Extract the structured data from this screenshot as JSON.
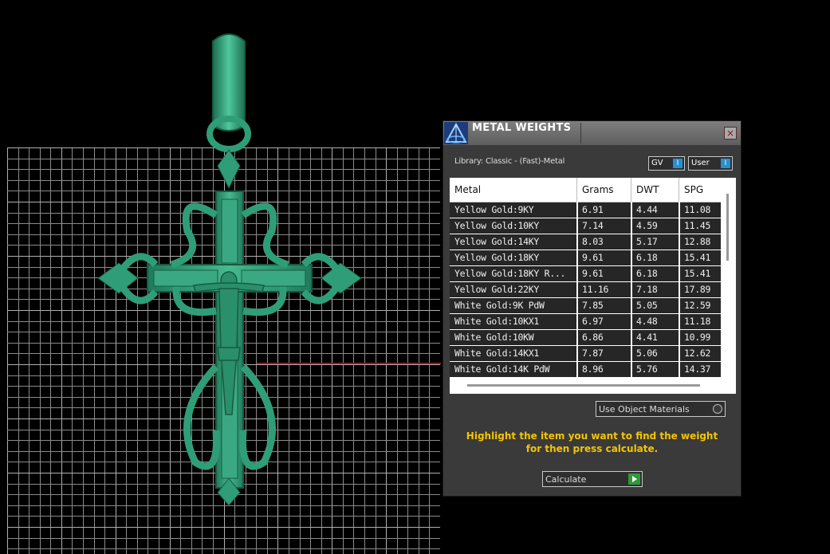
{
  "panel": {
    "title": "METAL WEIGHTS",
    "close_glyph": "×",
    "library_label": "Library: Classic - (Fast)-Metal",
    "toggles": {
      "gv_label": "GV",
      "user_label": "User",
      "indicator_glyph": "I"
    },
    "table": {
      "headers": [
        "Metal",
        "Grams",
        "DWT",
        "SPG"
      ],
      "rows": [
        {
          "metal": "Yellow Gold:9KY",
          "grams": "6.91",
          "dwt": "4.44",
          "spg": "11.08"
        },
        {
          "metal": "Yellow Gold:10KY",
          "grams": "7.14",
          "dwt": "4.59",
          "spg": "11.45"
        },
        {
          "metal": "Yellow Gold:14KY",
          "grams": "8.03",
          "dwt": "5.17",
          "spg": "12.88"
        },
        {
          "metal": "Yellow Gold:18KY",
          "grams": "9.61",
          "dwt": "6.18",
          "spg": "15.41"
        },
        {
          "metal": "Yellow Gold:18KY R...",
          "grams": "9.61",
          "dwt": "6.18",
          "spg": "15.41"
        },
        {
          "metal": "Yellow Gold:22KY",
          "grams": "11.16",
          "dwt": "7.18",
          "spg": "17.89"
        },
        {
          "metal": "White Gold:9K PdW",
          "grams": "7.85",
          "dwt": "5.05",
          "spg": "12.59"
        },
        {
          "metal": "White Gold:10KX1",
          "grams": "6.97",
          "dwt": "4.48",
          "spg": "11.18"
        },
        {
          "metal": "White Gold:10KW",
          "grams": "6.86",
          "dwt": "4.41",
          "spg": "10.99"
        },
        {
          "metal": "White Gold:14KX1",
          "grams": "7.87",
          "dwt": "5.06",
          "spg": "12.62"
        },
        {
          "metal": "White Gold:14K PdW",
          "grams": "8.96",
          "dwt": "5.76",
          "spg": "14.37"
        }
      ]
    },
    "use_object_materials_label": "Use Object Materials",
    "hint_line1": "Highlight the item you want to find the weight",
    "hint_line2": "for then press calculate.",
    "calculate_label": "Calculate"
  },
  "colors": {
    "viewport_bg": "#000000",
    "grid_line": "#8a8a8a",
    "model_green": "#2f9e78",
    "axis_red": "#b01010",
    "panel_bg": "#3a3a3a",
    "hint_text": "#f5c400",
    "toggle_indicator": "#2a8fcf",
    "play_green": "#2f9a3a"
  }
}
